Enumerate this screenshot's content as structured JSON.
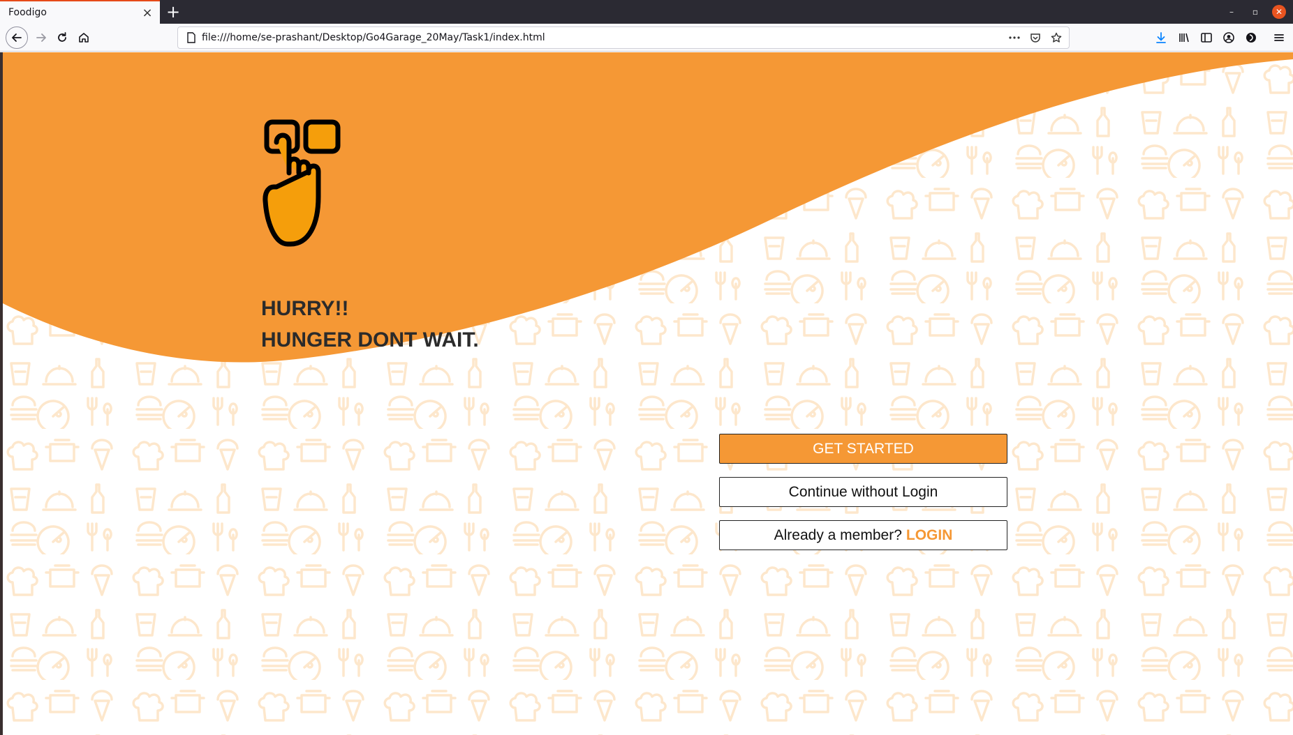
{
  "browser": {
    "tab_title": "Foodigo",
    "tab_close": "×",
    "new_tab": "+",
    "url": "file:///home/se-prashant/Desktop/Go4Garage_20May/Task1/index.html",
    "window_controls": {
      "minimize": "–",
      "restore": "▫",
      "close": "✕"
    },
    "icons": [
      "back-icon",
      "forward-icon",
      "reload-icon",
      "home-icon",
      "page-icon",
      "more-icon",
      "pocket-icon",
      "bookmark-star-icon",
      "download-icon",
      "library-icon",
      "sidebar-icon",
      "account-icon",
      "extension-icon",
      "menu-icon"
    ]
  },
  "hero": {
    "logo_icon": "tap-hand-icon",
    "headline_line1": "HURRY!!",
    "headline_line2": "HUNGER DONT WAIT."
  },
  "actions": {
    "get_started": "GET STARTED",
    "continue_without_login": "Continue without Login",
    "member_prompt": "Already a member?",
    "login_link": "LOGIN"
  },
  "colors": {
    "accent": "#f59835",
    "pattern": "#fde7cc",
    "text": "#2b2b2b"
  }
}
